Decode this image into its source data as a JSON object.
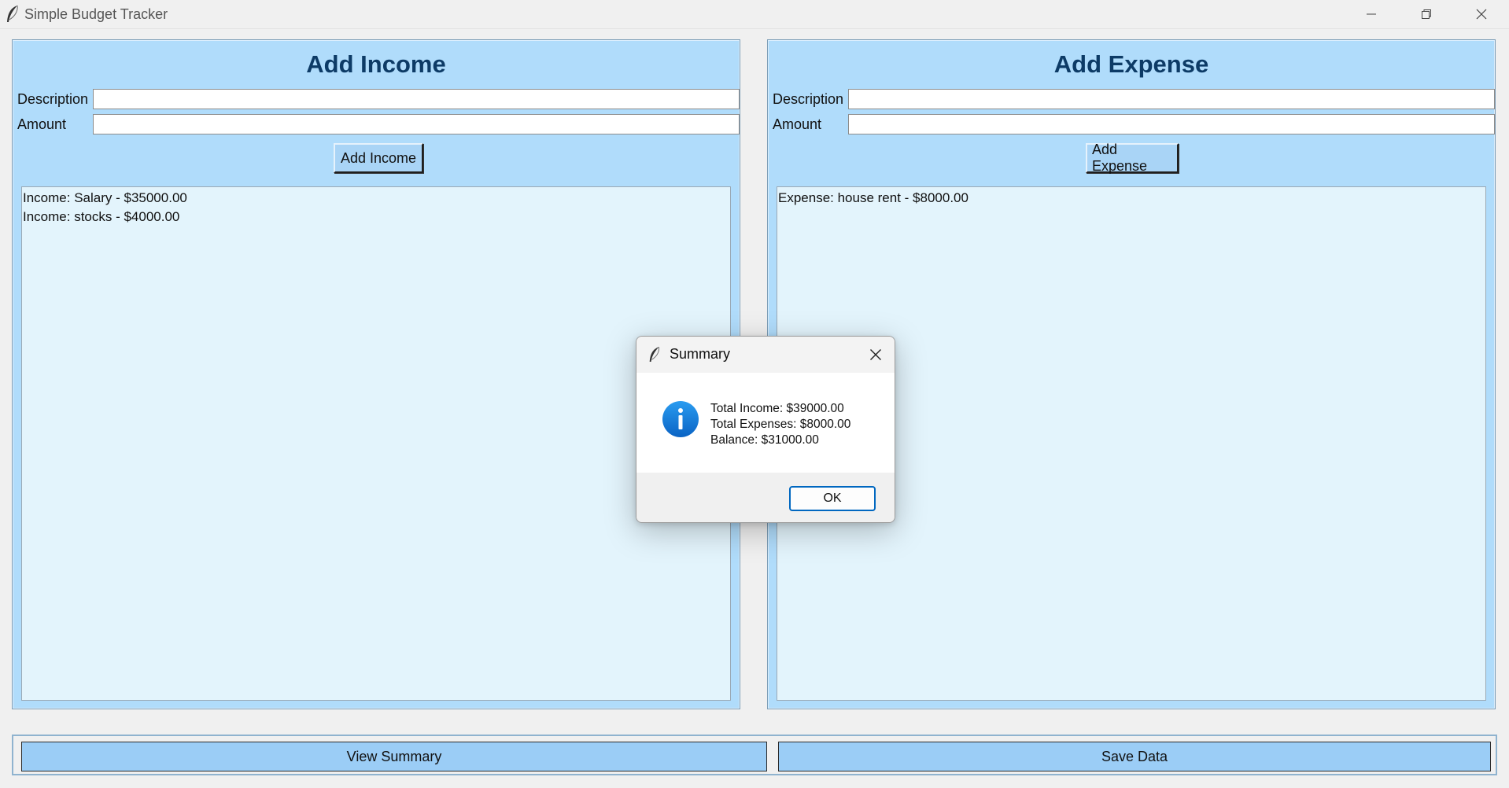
{
  "window": {
    "title": "Simple Budget Tracker",
    "icons": [
      "feather-icon",
      "minimize-icon",
      "restore-icon",
      "close-icon"
    ]
  },
  "income_panel": {
    "heading": "Add Income",
    "description_label": "Description",
    "amount_label": "Amount",
    "description_value": "",
    "amount_value": "",
    "button_label": "Add Income",
    "items": [
      "Income: Salary - $35000.00",
      "Income: stocks - $4000.00"
    ]
  },
  "expense_panel": {
    "heading": "Add Expense",
    "description_label": "Description",
    "amount_label": "Amount",
    "description_value": "",
    "amount_value": "",
    "button_label": "Add Expense",
    "items": [
      "Expense: house rent - $8000.00"
    ]
  },
  "bottom_bar": {
    "view_summary_label": "View Summary",
    "save_data_label": "Save Data"
  },
  "dialog": {
    "title": "Summary",
    "lines": [
      "Total Income: $39000.00",
      "Total Expenses: $8000.00",
      "Balance: $31000.00"
    ],
    "ok_label": "OK",
    "icon": "info-icon"
  },
  "colors": {
    "panel_bg": "#b0dcfb",
    "list_bg": "#e3f4fc",
    "heading": "#0d3b66",
    "bottom_button_bg": "#9bcdf6",
    "dialog_accent": "#0067c0"
  }
}
